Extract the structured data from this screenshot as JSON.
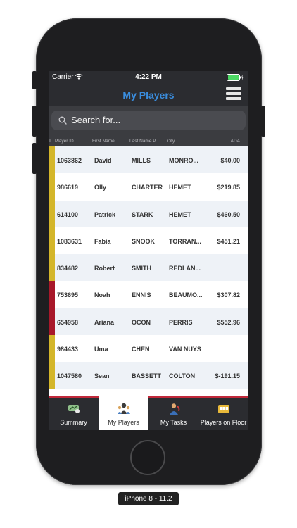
{
  "status_bar": {
    "carrier": "Carrier",
    "time": "4:22 PM"
  },
  "nav": {
    "title": "My Players"
  },
  "search": {
    "placeholder": "Search for..."
  },
  "table": {
    "headers": {
      "t": "T.",
      "player_id": "Player ID",
      "first_name": "First Name",
      "last_name": "Last Name P...",
      "city": "City",
      "ada": "ADA"
    },
    "rows": [
      {
        "status_color": "#d4b62a",
        "player_id": "1063862",
        "first": "David",
        "last": "MILLS",
        "city": "MONRO...",
        "ada": "$40.00"
      },
      {
        "status_color": "#d4b62a",
        "player_id": "986619",
        "first": "Olly",
        "last": "CHARTER",
        "city": "HEMET",
        "ada": "$219.85"
      },
      {
        "status_color": "#d4b62a",
        "player_id": "614100",
        "first": "Patrick",
        "last": "STARK",
        "city": "HEMET",
        "ada": "$460.50"
      },
      {
        "status_color": "#d4b62a",
        "player_id": "1083631",
        "first": "Fabia",
        "last": "SNOOK",
        "city": "TORRAN...",
        "ada": "$451.21"
      },
      {
        "status_color": "#d4b62a",
        "player_id": "834482",
        "first": "Robert",
        "last": "SMITH",
        "city": "REDLAN...",
        "ada": ""
      },
      {
        "status_color": "#a8182a",
        "player_id": "753695",
        "first": "Noah",
        "last": "ENNIS",
        "city": "BEAUMO...",
        "ada": "$307.82"
      },
      {
        "status_color": "#a8182a",
        "player_id": "654958",
        "first": "Ariana",
        "last": "OCON",
        "city": "PERRIS",
        "ada": "$552.96"
      },
      {
        "status_color": "#d4b62a",
        "player_id": "984433",
        "first": "Uma",
        "last": "CHEN",
        "city": "VAN NUYS",
        "ada": ""
      },
      {
        "status_color": "#d4b62a",
        "player_id": "1047580",
        "first": "Sean",
        "last": "BASSETT",
        "city": "COLTON",
        "ada": "$-191.15"
      }
    ]
  },
  "tabs": {
    "summary": "Summary",
    "my_players": "My Players",
    "my_tasks": "My Tasks",
    "players_on_floor": "Players on Floor",
    "active": "my_players"
  },
  "device_label": "iPhone 8 - 11.2",
  "colors": {
    "accent": "#3a8dde",
    "status_yellow": "#d4b62a",
    "status_red": "#a8182a",
    "tab_highlight": "#c0283a"
  }
}
